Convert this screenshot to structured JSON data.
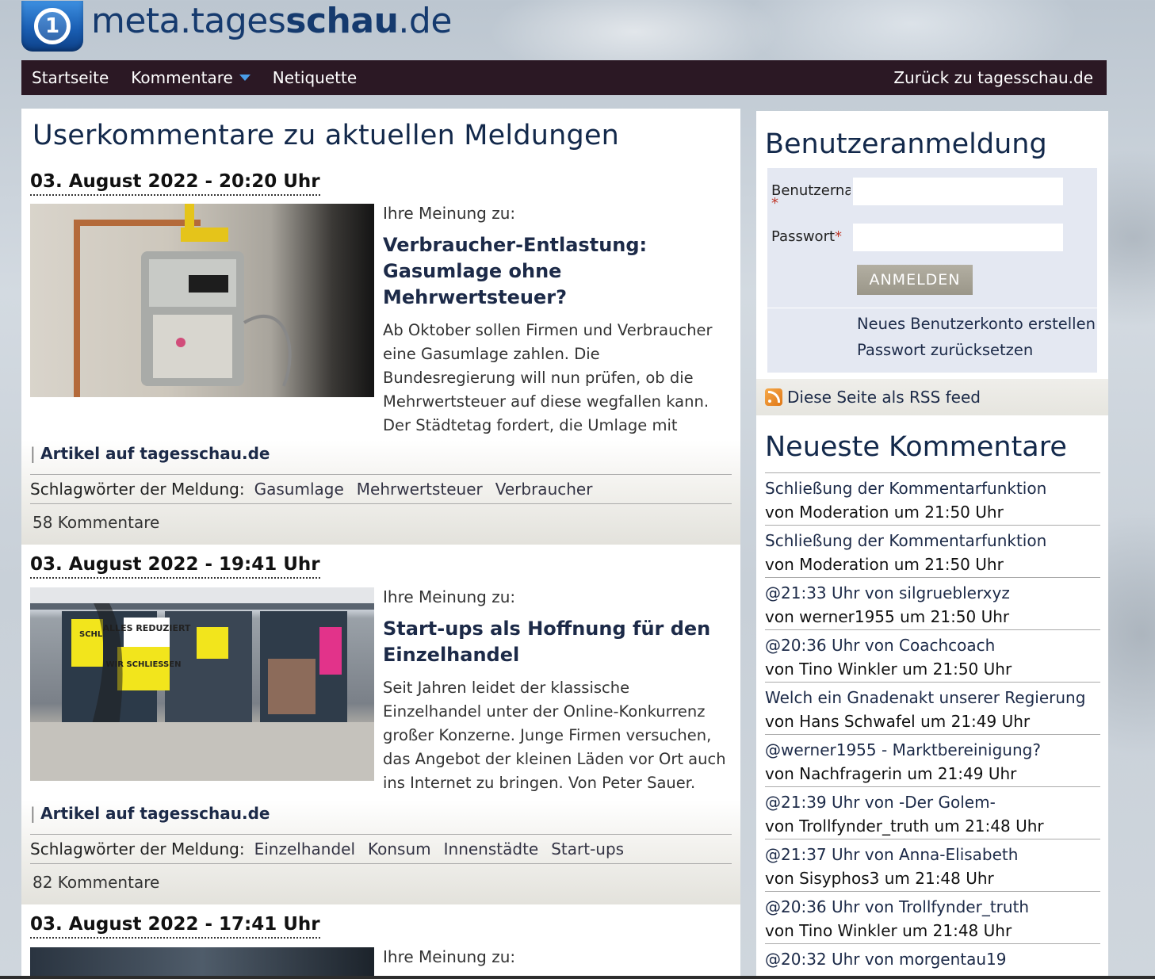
{
  "header": {
    "logo_mark": "1",
    "site_name_pre": "meta.tages",
    "site_name_bold": "schau",
    "site_name_post": ".de"
  },
  "nav": {
    "items": [
      "Startseite",
      "Kommentare",
      "Netiquette"
    ],
    "back_label": "Zurück zu tagesschau.de"
  },
  "main": {
    "page_title": "Userkommentare zu aktuellen Meldungen",
    "articles": [
      {
        "date": "03. August 2022 - 20:20 Uhr",
        "lead": "Ihre Meinung zu:",
        "title": "Verbraucher-Entlastung: Gasumlage ohne Mehrwertsteuer?",
        "text": "Ab Oktober sollen Firmen und Verbraucher eine Gasumlage zahlen. Die Bundesregierung will nun prüfen, ob die Mehrwertsteuer auf diese wegfallen kann. Der Städtetag fordert, die Umlage mit staatlichen Zuschüsse zu verringern.",
        "link": "Artikel auf tagesschau.de",
        "tags_label": "Schlagwörter der Meldung:",
        "tags": [
          "Gasumlage",
          "Mehrwertsteuer",
          "Verbraucher"
        ],
        "comments": "58 Kommentare",
        "image": "gas-meter-photo"
      },
      {
        "date": "03. August 2022 - 19:41 Uhr",
        "lead": "Ihre Meinung zu:",
        "title": "Start-ups als Hoffnung für den Einzelhandel",
        "text": "Seit Jahren leidet der klassische Einzelhandel unter der Online-Konkurrenz großer Konzerne. Junge Firmen versuchen, das Angebot der kleinen Läden vor Ort auch ins Internet zu bringen. Von Peter Sauer.",
        "link": "Artikel auf tagesschau.de",
        "tags_label": "Schlagwörter der Meldung:",
        "tags": [
          "Einzelhandel",
          "Konsum",
          "Innenstädte",
          "Start-ups"
        ],
        "comments": "82 Kommentare",
        "image": "storefront-photo",
        "image_signs": [
          "ALLES REDUZIERT",
          "WIR SCHLIESSEN",
          "SCHL",
          "EN"
        ]
      },
      {
        "date": "03. August 2022 - 17:41 Uhr",
        "lead": "Ihre Meinung zu:",
        "image": "city-photo"
      }
    ]
  },
  "sidebar": {
    "login_title": "Benutzeranmeldung",
    "username_label": "Benutzername",
    "password_label": "Passwort",
    "required_mark": "*",
    "login_button": "ANMELDEN",
    "links": [
      "Neues Benutzerkonto erstellen",
      "Passwort zurücksetzen"
    ],
    "rss_label": "Diese Seite als RSS feed",
    "newest_title": "Neueste Kommentare",
    "comments": [
      {
        "title": "Schließung der Kommentarfunktion",
        "meta": "von Moderation um 21:50 Uhr"
      },
      {
        "title": "Schließung der Kommentarfunktion",
        "meta": "von Moderation um 21:50 Uhr"
      },
      {
        "title": "@21:33 Uhr von silgrueblerxyz",
        "meta": "von werner1955 um 21:50 Uhr"
      },
      {
        "title": "@20:36 Uhr von Coachcoach",
        "meta": "von Tino Winkler um 21:50 Uhr"
      },
      {
        "title": "Welch ein Gnadenakt unserer Regierung",
        "meta": "von Hans Schwafel um 21:49 Uhr"
      },
      {
        "title": "@werner1955 - Marktbereinigung?",
        "meta": "von Nachfragerin um 21:49 Uhr"
      },
      {
        "title": "@21:39 Uhr von -Der Golem-",
        "meta": "von Trollfynder_truth um 21:48 Uhr"
      },
      {
        "title": "@21:37 Uhr von Anna-Elisabeth",
        "meta": "von Sisyphos3 um 21:48 Uhr"
      },
      {
        "title": "@20:36 Uhr von Trollfynder_truth",
        "meta": "von Tino Winkler um 21:48 Uhr"
      },
      {
        "title": "@20:32 Uhr von morgentau19",
        "meta": ""
      }
    ]
  },
  "colors": {
    "nav_bg": "#2b1824",
    "accent_blue": "#4a9de8",
    "title_navy": "#13294b",
    "login_box_bg": "#e4e8f2",
    "required_red": "#c0392b"
  }
}
